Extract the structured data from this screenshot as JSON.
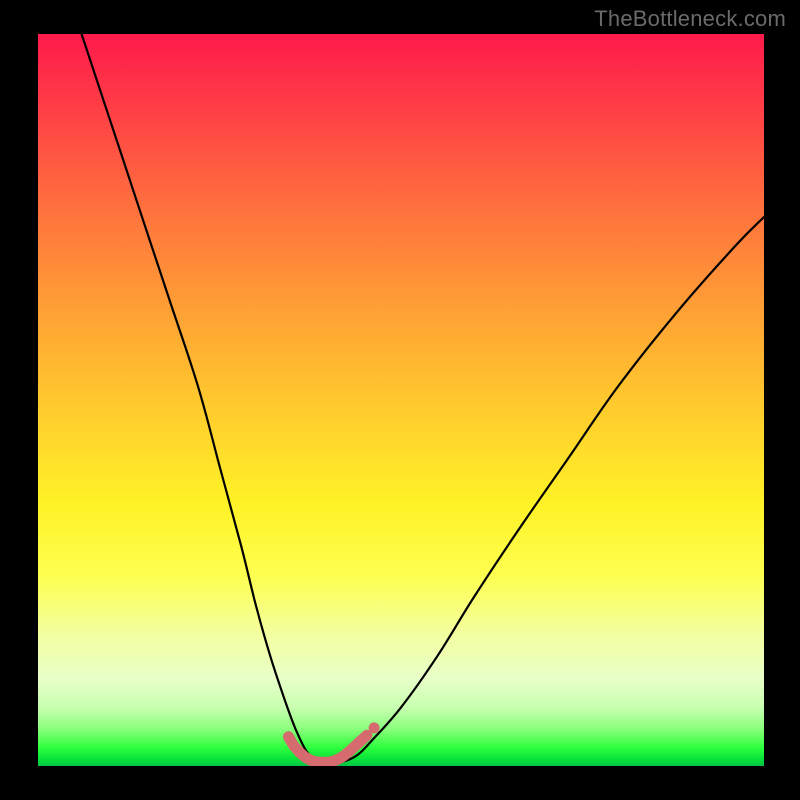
{
  "watermark": "TheBottleneck.com",
  "chart_data": {
    "type": "line",
    "title": "",
    "xlabel": "",
    "ylabel": "",
    "xlim": [
      0,
      100
    ],
    "ylim": [
      0,
      100
    ],
    "grid": false,
    "legend": false,
    "background_gradient": {
      "top_color": "#ff1a4b",
      "bottom_color": "#06c245",
      "meaning": "red=high bottleneck, green=low bottleneck"
    },
    "series": [
      {
        "name": "bottleneck-curve",
        "color": "#000000",
        "x": [
          6,
          10,
          14,
          18,
          22,
          25,
          28,
          30,
          32,
          34,
          35.5,
          37,
          38.5,
          40,
          42,
          44,
          46,
          50,
          55,
          60,
          66,
          73,
          80,
          88,
          96,
          100
        ],
        "y": [
          100,
          88,
          76,
          64,
          52,
          41,
          30,
          22,
          15,
          9,
          5,
          2,
          0.8,
          0.5,
          0.6,
          1.5,
          3.5,
          8,
          15,
          23,
          32,
          42,
          52,
          62,
          71,
          75
        ]
      },
      {
        "name": "minimum-marker",
        "color": "#d56a6f",
        "style": "thick-dots",
        "x": [
          34.5,
          35.2,
          36.0,
          36.8,
          37.5,
          38.2,
          39.0,
          39.8,
          40.5,
          41.3,
          42.0,
          43.0,
          44.2,
          45.3
        ],
        "y": [
          4.0,
          2.8,
          1.9,
          1.2,
          0.8,
          0.6,
          0.5,
          0.5,
          0.6,
          0.9,
          1.3,
          2.1,
          3.2,
          4.2
        ]
      }
    ],
    "annotations": []
  }
}
